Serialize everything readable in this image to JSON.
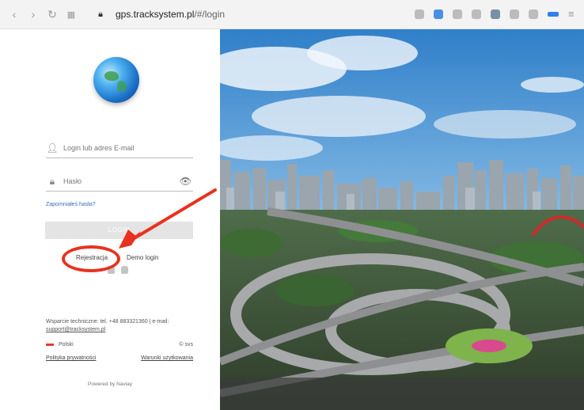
{
  "browser": {
    "url_host": "gps.tracksystem.pl",
    "url_path": "/#/login",
    "nav_icons": [
      "back-icon",
      "forward-icon",
      "reload-icon",
      "grid-icon",
      "lock-icon"
    ],
    "extension_icons": [
      "camera-icon",
      "shield-icon",
      "send-icon",
      "heart-icon",
      "image-icon",
      "box-icon",
      "download-icon",
      "battery-icon",
      "menu-icon"
    ]
  },
  "login": {
    "login_placeholder": "Login lub adres E-mail",
    "password_placeholder": "Hasło",
    "forgot": "Zapomniałeś hasła?",
    "button": "LOGIN",
    "register": "Rejestracja",
    "demo": "Demo login",
    "support_text": "Wsparcie techniczne: tel. +48 883321360 | e-mail:",
    "support_email": "support@tracksystem.pl",
    "language": "Polski",
    "copyright": "© svs",
    "privacy": "Polityka prywatności",
    "terms": "Warunki użytkowania",
    "powered": "Powered by Naviay"
  },
  "colors": {
    "annotation": "#e8321f",
    "link": "#3b6fb0"
  }
}
